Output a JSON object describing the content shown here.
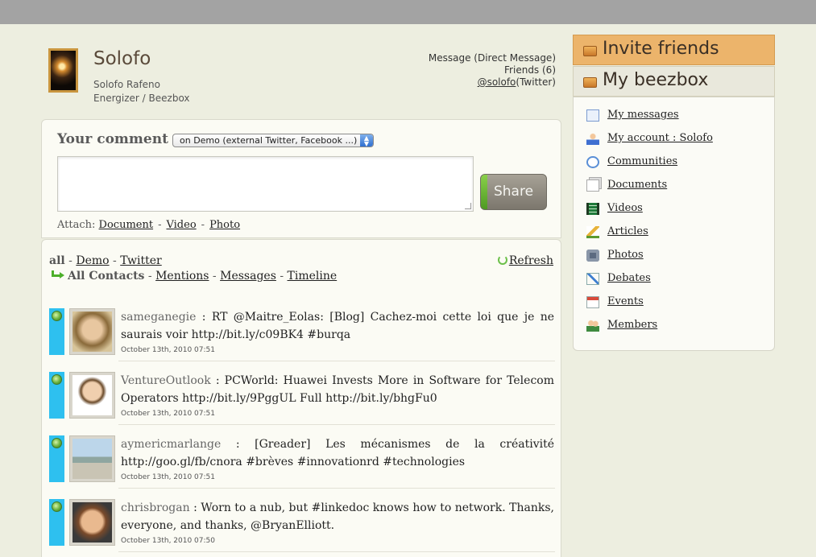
{
  "profile": {
    "name": "Solofo",
    "full_name": "Solofo Rafeno",
    "role": "Energizer / Beezbox",
    "links": {
      "message": "Message (Direct Message)",
      "friends": "Friends (6)",
      "twitter_handle": "@solofo",
      "twitter_suffix": "(Twitter)"
    }
  },
  "comment": {
    "title": "Your comment",
    "target_select": "on Demo (external Twitter, Facebook ...)",
    "textarea_value": "",
    "share_label": "Share",
    "attach_label": "Attach:",
    "attach_document": "Document",
    "attach_video": "Video",
    "attach_photo": "Photo",
    "sep": "-"
  },
  "feed": {
    "filters": {
      "all": "all",
      "demo": "Demo",
      "twitter": "Twitter",
      "all_contacts": "All Contacts",
      "mentions": "Mentions",
      "messages": "Messages",
      "timeline": "Timeline",
      "sep": "-"
    },
    "refresh_label": "Refresh",
    "items": [
      {
        "user": "sameganegie",
        "text": "RT @Maitre_Eolas: [Blog] Cachez-moi cette loi que je ne saurais voir http://bit.ly/c09BK4 #burqa",
        "date": "October 13th, 2010 07:51"
      },
      {
        "user": "VentureOutlook",
        "text": "PCWorld: Huawei Invests More in Software for Telecom Operators http://bit.ly/9PggUL Full http://bit.ly/bhgFu0",
        "date": "October 13th, 2010 07:51"
      },
      {
        "user": "aymericmarlange",
        "text": "[Greader] Les mécanismes de la créativité http://goo.gl/fb/cnora #brèves #innovationrd #technologies",
        "date": "October 13th, 2010 07:51"
      },
      {
        "user": "chrisbrogan",
        "text": "Worn to a nub, but #linkedoc knows how to network. Thanks, everyone, and thanks, @BryanElliott.",
        "date": "October 13th, 2010 07:50"
      }
    ]
  },
  "sidebar": {
    "invite_tab": "Invite friends",
    "beezbox_tab": "My beezbox",
    "menu": [
      {
        "label": "My messages",
        "icon": "mail-icon"
      },
      {
        "label": "My account : Solofo",
        "icon": "person-icon"
      },
      {
        "label": "Communities",
        "icon": "speech-bubbles-icon"
      },
      {
        "label": "Documents",
        "icon": "documents-icon"
      },
      {
        "label": "Videos",
        "icon": "film-icon"
      },
      {
        "label": "Articles",
        "icon": "pencil-icon"
      },
      {
        "label": "Photos",
        "icon": "camera-icon"
      },
      {
        "label": "Debates",
        "icon": "checkmark-icon"
      },
      {
        "label": "Events",
        "icon": "calendar-icon"
      },
      {
        "label": "Members",
        "icon": "members-icon"
      }
    ]
  }
}
